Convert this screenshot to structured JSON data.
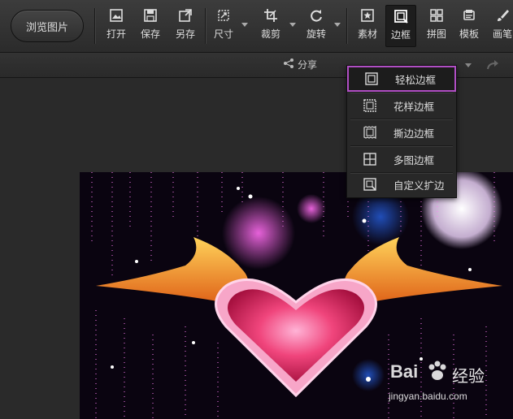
{
  "toolbar": {
    "browse_label": "浏览图片",
    "items": [
      {
        "label": "打开",
        "icon": "open-icon"
      },
      {
        "label": "保存",
        "icon": "save-icon"
      },
      {
        "label": "另存",
        "icon": "save-as-icon"
      },
      {
        "label": "尺寸",
        "icon": "resize-icon"
      },
      {
        "label": "裁剪",
        "icon": "crop-icon"
      },
      {
        "label": "旋转",
        "icon": "rotate-icon"
      },
      {
        "label": "素材",
        "icon": "material-icon"
      },
      {
        "label": "边框",
        "icon": "border-icon"
      },
      {
        "label": "拼图",
        "icon": "collage-icon"
      },
      {
        "label": "模板",
        "icon": "template-icon"
      },
      {
        "label": "画笔",
        "icon": "brush-icon"
      }
    ]
  },
  "subbar": {
    "share_label": "分享"
  },
  "border_menu": {
    "items": [
      {
        "label": "轻松边框",
        "icon": "simple-border-icon",
        "selected": true
      },
      {
        "label": "花样边框",
        "icon": "pattern-border-icon"
      },
      {
        "label": "撕边边框",
        "icon": "torn-border-icon"
      },
      {
        "label": "多图边框",
        "icon": "multi-image-border-icon"
      },
      {
        "label": "自定义扩边",
        "icon": "custom-expand-icon"
      }
    ],
    "highlight_color": "#b04ec4"
  },
  "watermark": {
    "brand": "Bai",
    "brand2": "经验",
    "url": "jingyan.baidu.com"
  }
}
